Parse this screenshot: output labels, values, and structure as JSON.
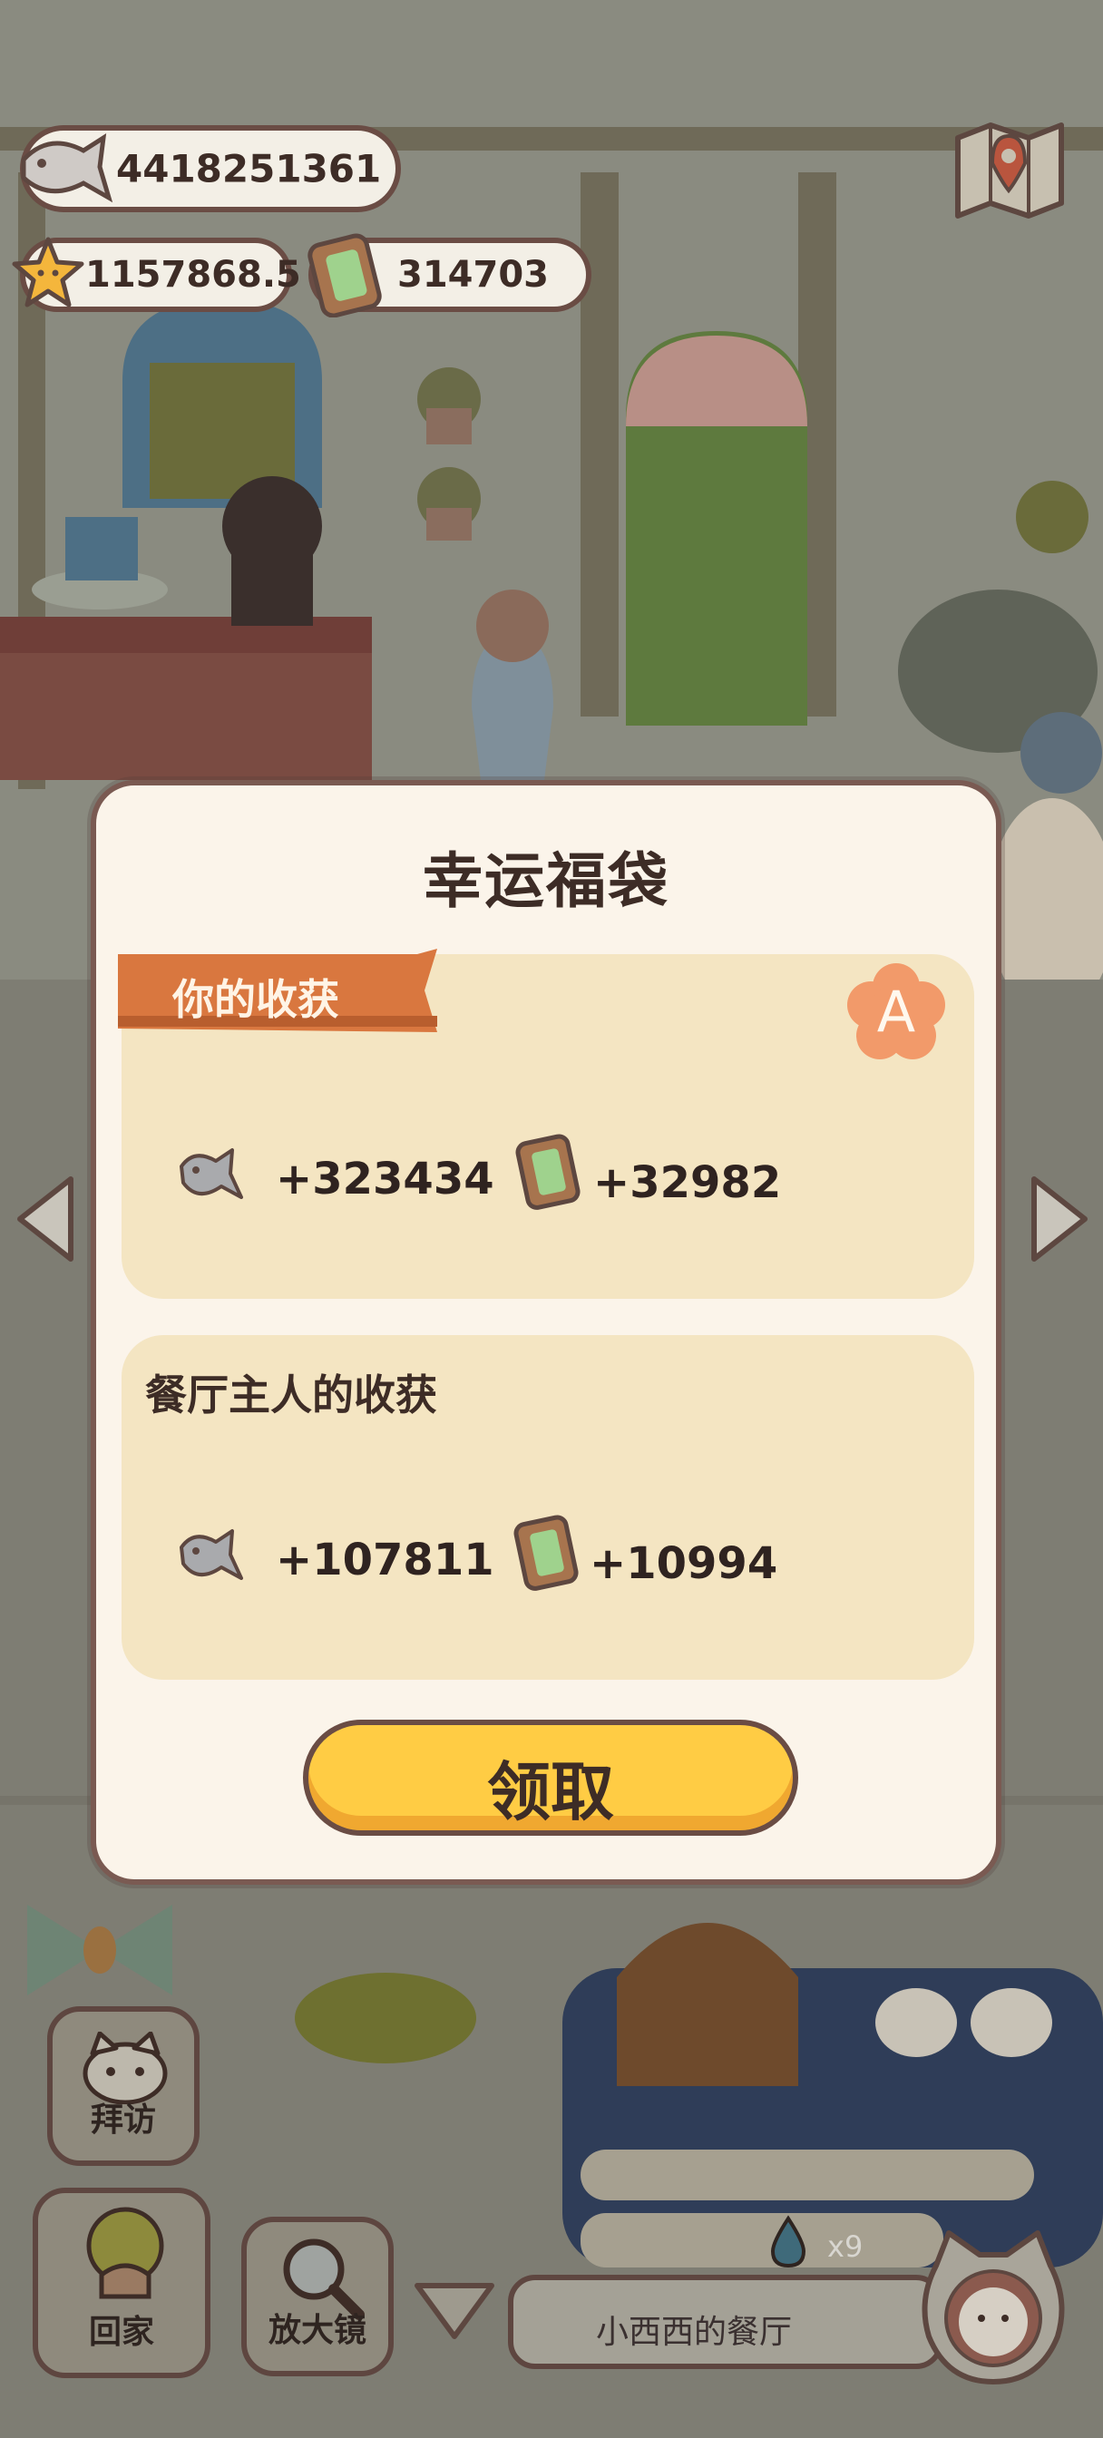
{
  "hud": {
    "fish_amount": "4418251361",
    "star_amount": "1157868.5",
    "battery_amount": "314703"
  },
  "modal": {
    "title": "幸运福袋",
    "yours": {
      "label": "你的收获",
      "grade": "A",
      "fish_reward": "+323434",
      "battery_reward": "+32982"
    },
    "owner": {
      "label": "餐厅主人的收获",
      "fish_reward": "+107811",
      "battery_reward": "+10994"
    },
    "claim_label": "领取"
  },
  "bottom_bar": {
    "visit_label": "拜访",
    "home_label": "回家",
    "magnifier_label": "放大镜",
    "restaurant_name": "小西西的餐厅",
    "water_count": "x9"
  },
  "colors": {
    "modal_bg": "#fbf4ea",
    "card_bg": "#f4e5c2",
    "ribbon": "#d9773f",
    "badge": "#f29a6a",
    "claim_button": "#ffcc44",
    "outline": "#6a4c44"
  },
  "icons": [
    "fish-icon",
    "star-icon",
    "battery-icon",
    "map-icon",
    "left-arrow-icon",
    "right-arrow-icon",
    "chevron-down-icon",
    "magnifier-icon",
    "water-drop-icon",
    "cat-avatar-icon"
  ]
}
